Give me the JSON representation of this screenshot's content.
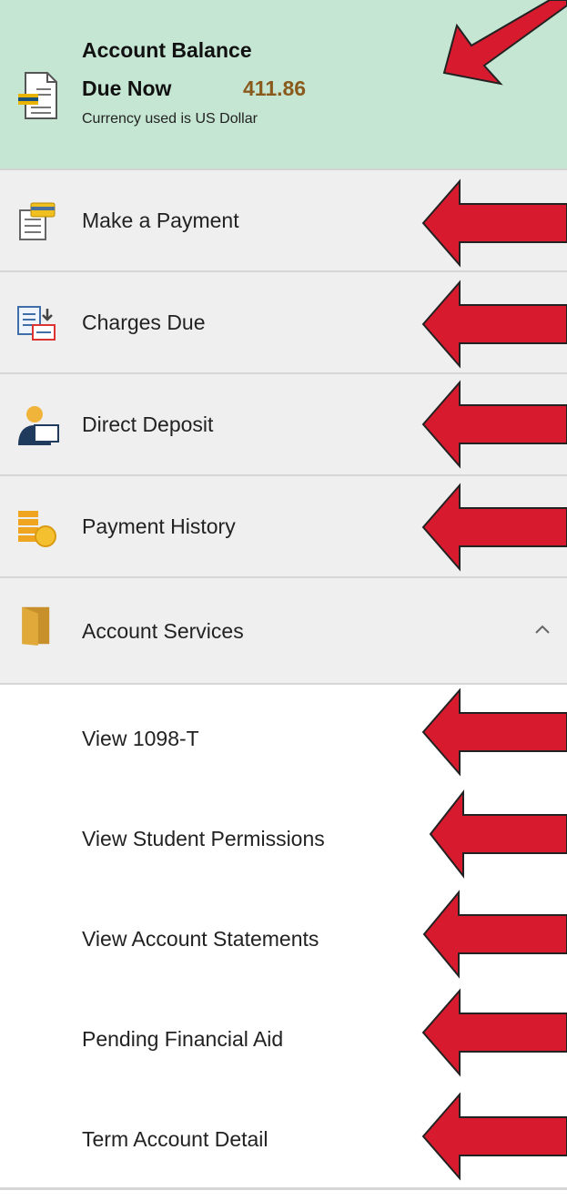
{
  "balance": {
    "title": "Account Balance",
    "due_label": "Due Now",
    "amount": "411.86",
    "currency_note": "Currency used is US Dollar",
    "icon": "bill-document-icon"
  },
  "nav_items": [
    {
      "label": "Make a Payment",
      "icon": "payment-card-icon"
    },
    {
      "label": "Charges Due",
      "icon": "charges-due-icon"
    },
    {
      "label": "Direct Deposit",
      "icon": "direct-deposit-icon"
    },
    {
      "label": "Payment History",
      "icon": "coin-stack-icon"
    },
    {
      "label": "Account Services",
      "icon": "folder-icon",
      "expanded": true
    }
  ],
  "sub_items": [
    {
      "label": "View 1098-T"
    },
    {
      "label": "View Student Permissions"
    },
    {
      "label": "View Account Statements"
    },
    {
      "label": "Pending Financial Aid"
    },
    {
      "label": "Term Account Detail"
    }
  ],
  "colors": {
    "balance_bg": "#c5e6d3",
    "nav_bg": "#efefef",
    "amount": "#8a5a1c",
    "arrow": "#d71a2e"
  }
}
